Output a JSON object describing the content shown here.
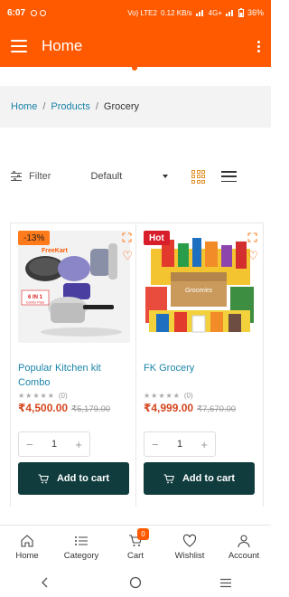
{
  "status_bar": {
    "time": "6:07",
    "network": "Vo) LTE2",
    "speed": "0.12 KB/s",
    "signal": "4G+",
    "battery": "36%"
  },
  "appbar": {
    "title": "Home"
  },
  "breadcrumb": {
    "home": "Home",
    "products": "Products",
    "current": "Grocery"
  },
  "toolbar": {
    "filter_label": "Filter",
    "sort_value": "Default"
  },
  "products": [
    {
      "badge": "-13%",
      "name": "Popular Kitchen kit Combo",
      "reviews": "(0)",
      "price": "₹4,500.00",
      "old_price": "₹5,179.00",
      "qty": "1",
      "cart_label": "Add to cart"
    },
    {
      "badge": "Hot",
      "name": "FK Grocery",
      "reviews": "(0)",
      "price": "₹4,999.00",
      "old_price": "₹7,670.00",
      "qty": "1",
      "cart_label": "Add to cart"
    }
  ],
  "product_image_text": {
    "brand": "FreeKart",
    "combo_line1": "6 IN 1",
    "combo_line2": "Combo Pack",
    "grocery_box": "Groceries"
  },
  "bottom_nav": {
    "home": "Home",
    "category": "Category",
    "cart": "Cart",
    "cart_count": "0",
    "wishlist": "Wishlist",
    "account": "Account"
  },
  "colors": {
    "primary": "#ff5a00",
    "link": "#1a84a8",
    "price": "#d4461e",
    "button": "#113c3e"
  }
}
